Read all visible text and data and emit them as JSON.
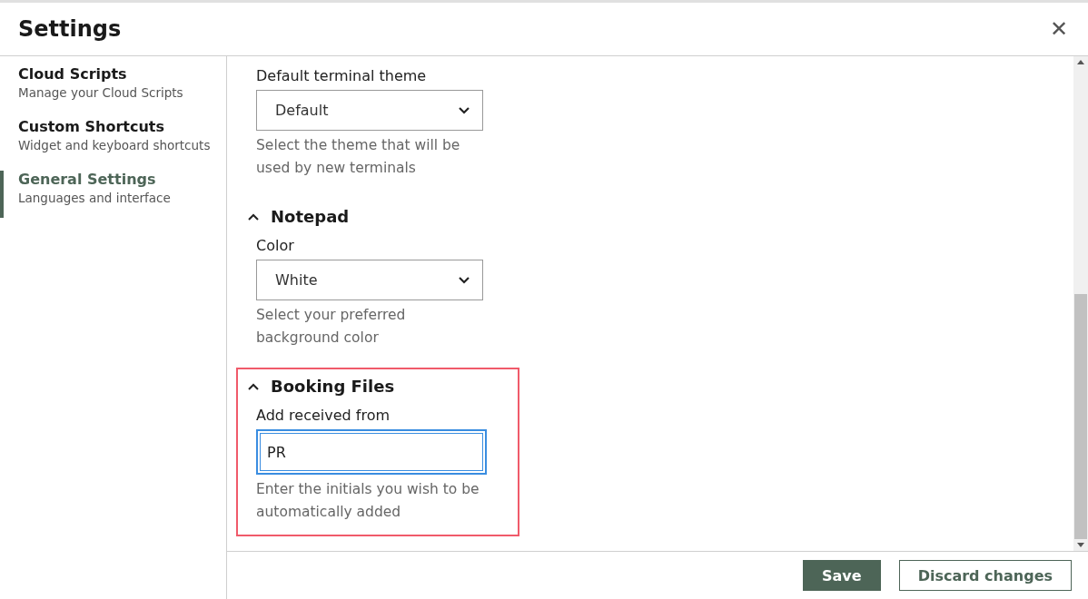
{
  "window": {
    "title": "Settings",
    "close_icon": "✕"
  },
  "sidebar": {
    "items": [
      {
        "title": "Cloud Scripts",
        "subtitle": "Manage your Cloud Scripts",
        "selected": false
      },
      {
        "title": "Custom Shortcuts",
        "subtitle": "Widget and keyboard shortcuts",
        "selected": false
      },
      {
        "title": "General Settings",
        "subtitle": "Languages and interface",
        "selected": true
      }
    ]
  },
  "sections": [
    {
      "fields": [
        {
          "kind": "select",
          "label": "Default terminal theme",
          "value": "Default",
          "help": "Select the theme that will be used by new terminals"
        }
      ]
    },
    {
      "heading": "Notepad",
      "expanded": true,
      "highlighted": false,
      "fields": [
        {
          "kind": "select",
          "label": "Color",
          "value": "White",
          "help": "Select your preferred background color"
        }
      ]
    },
    {
      "heading": "Booking Files",
      "expanded": true,
      "highlighted": true,
      "fields": [
        {
          "kind": "text",
          "label": "Add received from",
          "value": "PR",
          "focused": true,
          "help": "Enter the initials you wish to be automatically added"
        }
      ]
    }
  ],
  "buttons": [
    {
      "label": "Save",
      "kind": "primary"
    },
    {
      "label": "Discard changes",
      "kind": "secondary"
    }
  ]
}
